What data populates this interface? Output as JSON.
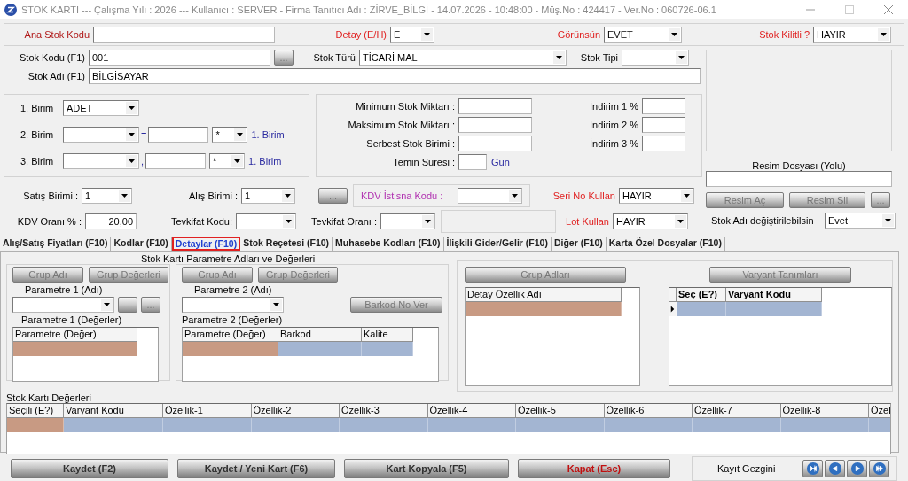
{
  "window": {
    "title": "STOK KARTI --- Çalışma Yılı : 2026 --- Kullanıcı : SERVER - Firma Tanıtıcı Adı : ZİRVE_BİLGİ - 14.07.2026 - 10:48:00 - Müş.No : 424417 - Ver.No : 060726-06.1"
  },
  "header": [
    {
      "label": "Ana Stok Kodu",
      "kind": "text"
    },
    {
      "label": "Detay (E/H)",
      "kind": "combo",
      "value": "E"
    },
    {
      "label": "Görünsün",
      "kind": "combo",
      "value": "EVET"
    },
    {
      "label": "Stok Kilitli ?",
      "kind": "combo",
      "value": "HAYIR"
    }
  ],
  "stock": {
    "code_label": "Stok Kodu (F1)",
    "code": "001",
    "browse": "...",
    "type_label": "Stok Türü",
    "type": "TİCARİ MAL",
    "kind_label": "Stok Tipi",
    "name_label": "Stok Adı (F1)",
    "name": "BİLGİSAYAR"
  },
  "units": [
    {
      "label": "1. Birim",
      "value": "ADET"
    },
    {
      "label": "2. Birim",
      "operator": "=",
      "factor": "*",
      "base": "1. Birim"
    },
    {
      "label": "3. Birim",
      "operator": ",",
      "factor": "*",
      "base": "1. Birim"
    }
  ],
  "limits": [
    {
      "label": "Minimum Stok Miktarı :"
    },
    {
      "label": "Maksimum Stok Miktarı :"
    },
    {
      "label": "Serbest Stok Birimi :"
    },
    {
      "label": "Temin Süresi :",
      "unit": "Gün"
    }
  ],
  "discounts": [
    {
      "label": "İndirim 1 %"
    },
    {
      "label": "İndirim 2 %"
    },
    {
      "label": "İndirim 3 %"
    }
  ],
  "sales_unit": {
    "label": "Satış Birimi :",
    "value": "1"
  },
  "purchase_unit": {
    "label": "Alış Birimi :",
    "value": "1"
  },
  "kdv_button": "...",
  "kdv_exemption": {
    "label": "KDV İstisna Kodu :"
  },
  "kdv_rate": {
    "label": "KDV Oranı % :",
    "value": "20,00"
  },
  "withholding_code": {
    "label": "Tevkifat Kodu:"
  },
  "withholding_rate": {
    "label": "Tevkifat Oranı :"
  },
  "tracking": [
    {
      "label": "Seri No Kullan",
      "value": "HAYIR"
    },
    {
      "label": "Lot Kullan",
      "value": "HAYIR"
    }
  ],
  "image": {
    "path_label": "Resim Dosyası (Yolu)",
    "buttons": [
      "Resim Aç",
      "Resim Sil",
      "..."
    ],
    "rename_label": "Stok Adı değiştirilebilsin",
    "rename_value": "Evet"
  },
  "tabs": [
    {
      "label": "Alış/Satış Fiyatları (F10)",
      "selected": false
    },
    {
      "label": "Kodlar (F10)",
      "selected": false
    },
    {
      "label": "Detaylar  (F10)",
      "selected": true
    },
    {
      "label": "Stok Reçetesi  (F10)",
      "selected": false
    },
    {
      "label": "Muhasebe Kodları (F10)",
      "selected": false
    },
    {
      "label": "İlişkili Gider/Gelir  (F10)",
      "selected": false
    },
    {
      "label": "Diğer (F10)",
      "selected": false
    },
    {
      "label": "Karta Özel Dosyalar (F10)",
      "selected": false
    }
  ],
  "parameters": {
    "title": "Stok Kartı Parametre Adları ve Değerleri",
    "panels": [
      {
        "buttons": [
          "Grup Adı",
          "Grup Değerleri"
        ],
        "name_label": "Parametre 1 (Adı)",
        "side_button": "...",
        "values_label": "Parametre 1 (Değerler)",
        "columns": [
          "Parametre (Değer)"
        ]
      },
      {
        "buttons": [
          "Grup Adı",
          "Grup Değerleri"
        ],
        "name_label": "Parametre 2 (Adı)",
        "action": "Barkod No Ver",
        "values_label": "Parametre 2 (Değerler)",
        "columns": [
          "Parametre (Değer)",
          "Barkod",
          "Kalite"
        ]
      }
    ]
  },
  "details": {
    "button": "Grup Adları",
    "columns": [
      "Detay Özellik Adı"
    ]
  },
  "variants": {
    "button": "Varyant Tanımları",
    "columns": [
      "Seç (E?)",
      "Varyant Kodu"
    ]
  },
  "values_grid": {
    "title": "Stok Kartı Değerleri",
    "columns": [
      "Seçili (E?)",
      "Varyant Kodu",
      "Özellik-1",
      "Özellik-2",
      "Özellik-3",
      "Özellik-4",
      "Özellik-5",
      "Özellik-6",
      "Özellik-7",
      "Özellik-8",
      "Özel"
    ]
  },
  "footer": {
    "buttons": [
      {
        "label": "Kaydet (F2)",
        "kind": "normal"
      },
      {
        "label": "Kaydet / Yeni Kart (F6)",
        "kind": "normal"
      },
      {
        "label": "Kart Kopyala (F5)",
        "kind": "normal"
      },
      {
        "label": "Kapat (Esc)",
        "kind": "danger"
      }
    ],
    "navigator": "Kayıt Gezgini"
  }
}
